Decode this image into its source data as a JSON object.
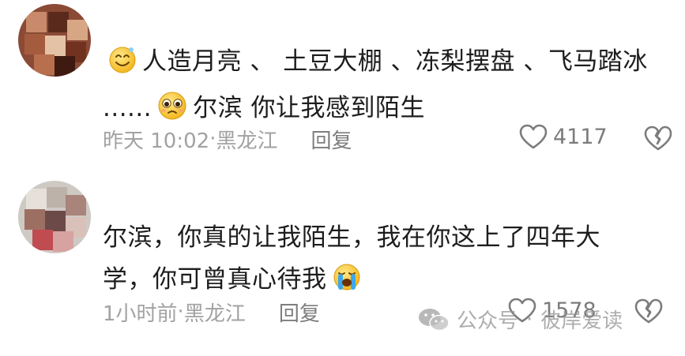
{
  "comments": [
    {
      "text_a": "人造月亮 、 土豆大棚 、冻梨摆盘 、飞马踏冰 ......",
      "text_b": "尔滨 你让我感到陌生",
      "time": "昨天 10:02",
      "location": "黑龙江",
      "reply_label": "回复",
      "like_count": "4117",
      "emoji_a": "smiling-face-emoji",
      "emoji_b": "pleading-face-emoji"
    },
    {
      "text": "尔滨，你真的让我陌生，我在你这上了四年大学，你可曾真心待我",
      "time": "1小时前",
      "location": "黑龙江",
      "reply_label": "回复",
      "like_count": "1578",
      "emoji": "loudly-crying-face-emoji"
    }
  ],
  "watermark": {
    "prefix": "公众号",
    "name": "彼岸爱读"
  },
  "colors": {
    "text": "#1d1d1d",
    "meta": "#a2a2a2",
    "icon": "#7c7c7c"
  }
}
